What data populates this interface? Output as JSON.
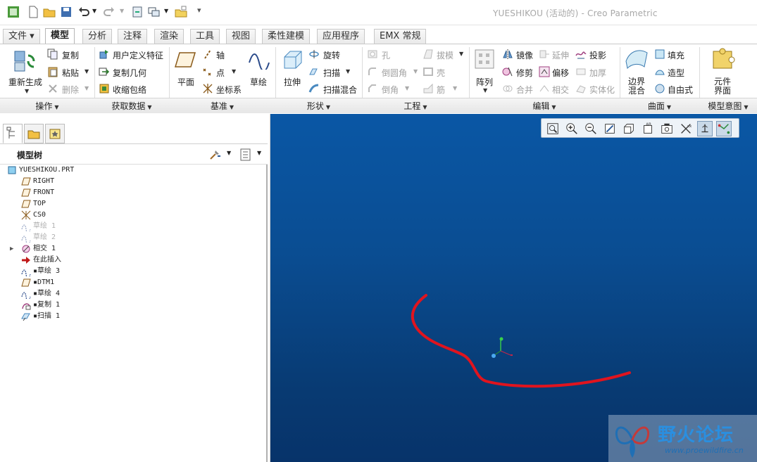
{
  "window": {
    "title": "YUESHIKOU (活动的) - Creo Parametric"
  },
  "tabs": [
    "文件 ▾",
    "模型",
    "分析",
    "注释",
    "渲染",
    "工具",
    "视图",
    "柔性建模",
    "应用程序",
    "EMX 常规"
  ],
  "ribbon": {
    "regenerate": "重新生成",
    "copy": "复制",
    "paste": "粘贴",
    "delete": "删除",
    "udf": "用户定义特征",
    "copy_geom": "复制几何",
    "shrinkwrap": "收缩包络",
    "plane": "平面",
    "axis": "轴",
    "point": "点",
    "csys": "坐标系",
    "sketch": "草绘",
    "extrude": "拉伸",
    "revolve": "旋转",
    "sweep": "扫描",
    "swept_blend": "扫描混合",
    "hole": "孔",
    "round": "倒圆角",
    "chamfer": "倒角",
    "draft": "拔模",
    "shell": "壳",
    "rib": "筋",
    "pattern": "阵列",
    "mirror": "镜像",
    "trim": "修剪",
    "merge": "合并",
    "extend": "延伸",
    "offset": "偏移",
    "intersect": "相交",
    "project": "投影",
    "thicken": "加厚",
    "solidify": "实体化",
    "boundary_blend_1": "边界",
    "boundary_blend_2": "混合",
    "fill": "填充",
    "style": "造型",
    "freestyle": "自由式",
    "component_interface_1": "元件",
    "component_interface_2": "界面"
  },
  "groups": [
    "操作",
    "获取数据",
    "基准",
    "形状",
    "工程",
    "编辑",
    "曲面",
    "模型意图"
  ],
  "tree": {
    "header": "模型树",
    "items": [
      {
        "label": "YUESHIKOU.PRT",
        "icon": "part-icon",
        "dim": false
      },
      {
        "label": "RIGHT",
        "icon": "datum-plane-icon",
        "dim": false
      },
      {
        "label": "FRONT",
        "icon": "datum-plane-icon",
        "dim": false
      },
      {
        "label": "TOP",
        "icon": "datum-plane-icon",
        "dim": false
      },
      {
        "label": "CS0",
        "icon": "csys-icon",
        "dim": false
      },
      {
        "label": "草绘 1",
        "icon": "sketch-icon",
        "dim": true
      },
      {
        "label": "草绘 2",
        "icon": "sketch-icon",
        "dim": true
      },
      {
        "label": "相交 1",
        "icon": "intersect-icon",
        "dim": false
      },
      {
        "label": "在此插入",
        "icon": "insert-here-arrow-icon",
        "dim": false
      },
      {
        "label": "▪草绘 3",
        "icon": "sketch-icon",
        "dim": false
      },
      {
        "label": "▪DTM1",
        "icon": "datum-plane-icon",
        "dim": false
      },
      {
        "label": "▪草绘 4",
        "icon": "sketch-icon",
        "dim": false
      },
      {
        "label": "▪复制 1",
        "icon": "copy-surface-icon",
        "dim": false
      },
      {
        "label": "▪扫描 1",
        "icon": "sweep-icon",
        "dim": false
      }
    ]
  },
  "watermark": {
    "title": "野火论坛",
    "url": "www.proewildfire.cn"
  },
  "colors": {
    "viewport_top": "#0a57a5",
    "viewport_bottom": "#07336a",
    "curve": "#e0141e",
    "accent": "#2a8fe0"
  }
}
